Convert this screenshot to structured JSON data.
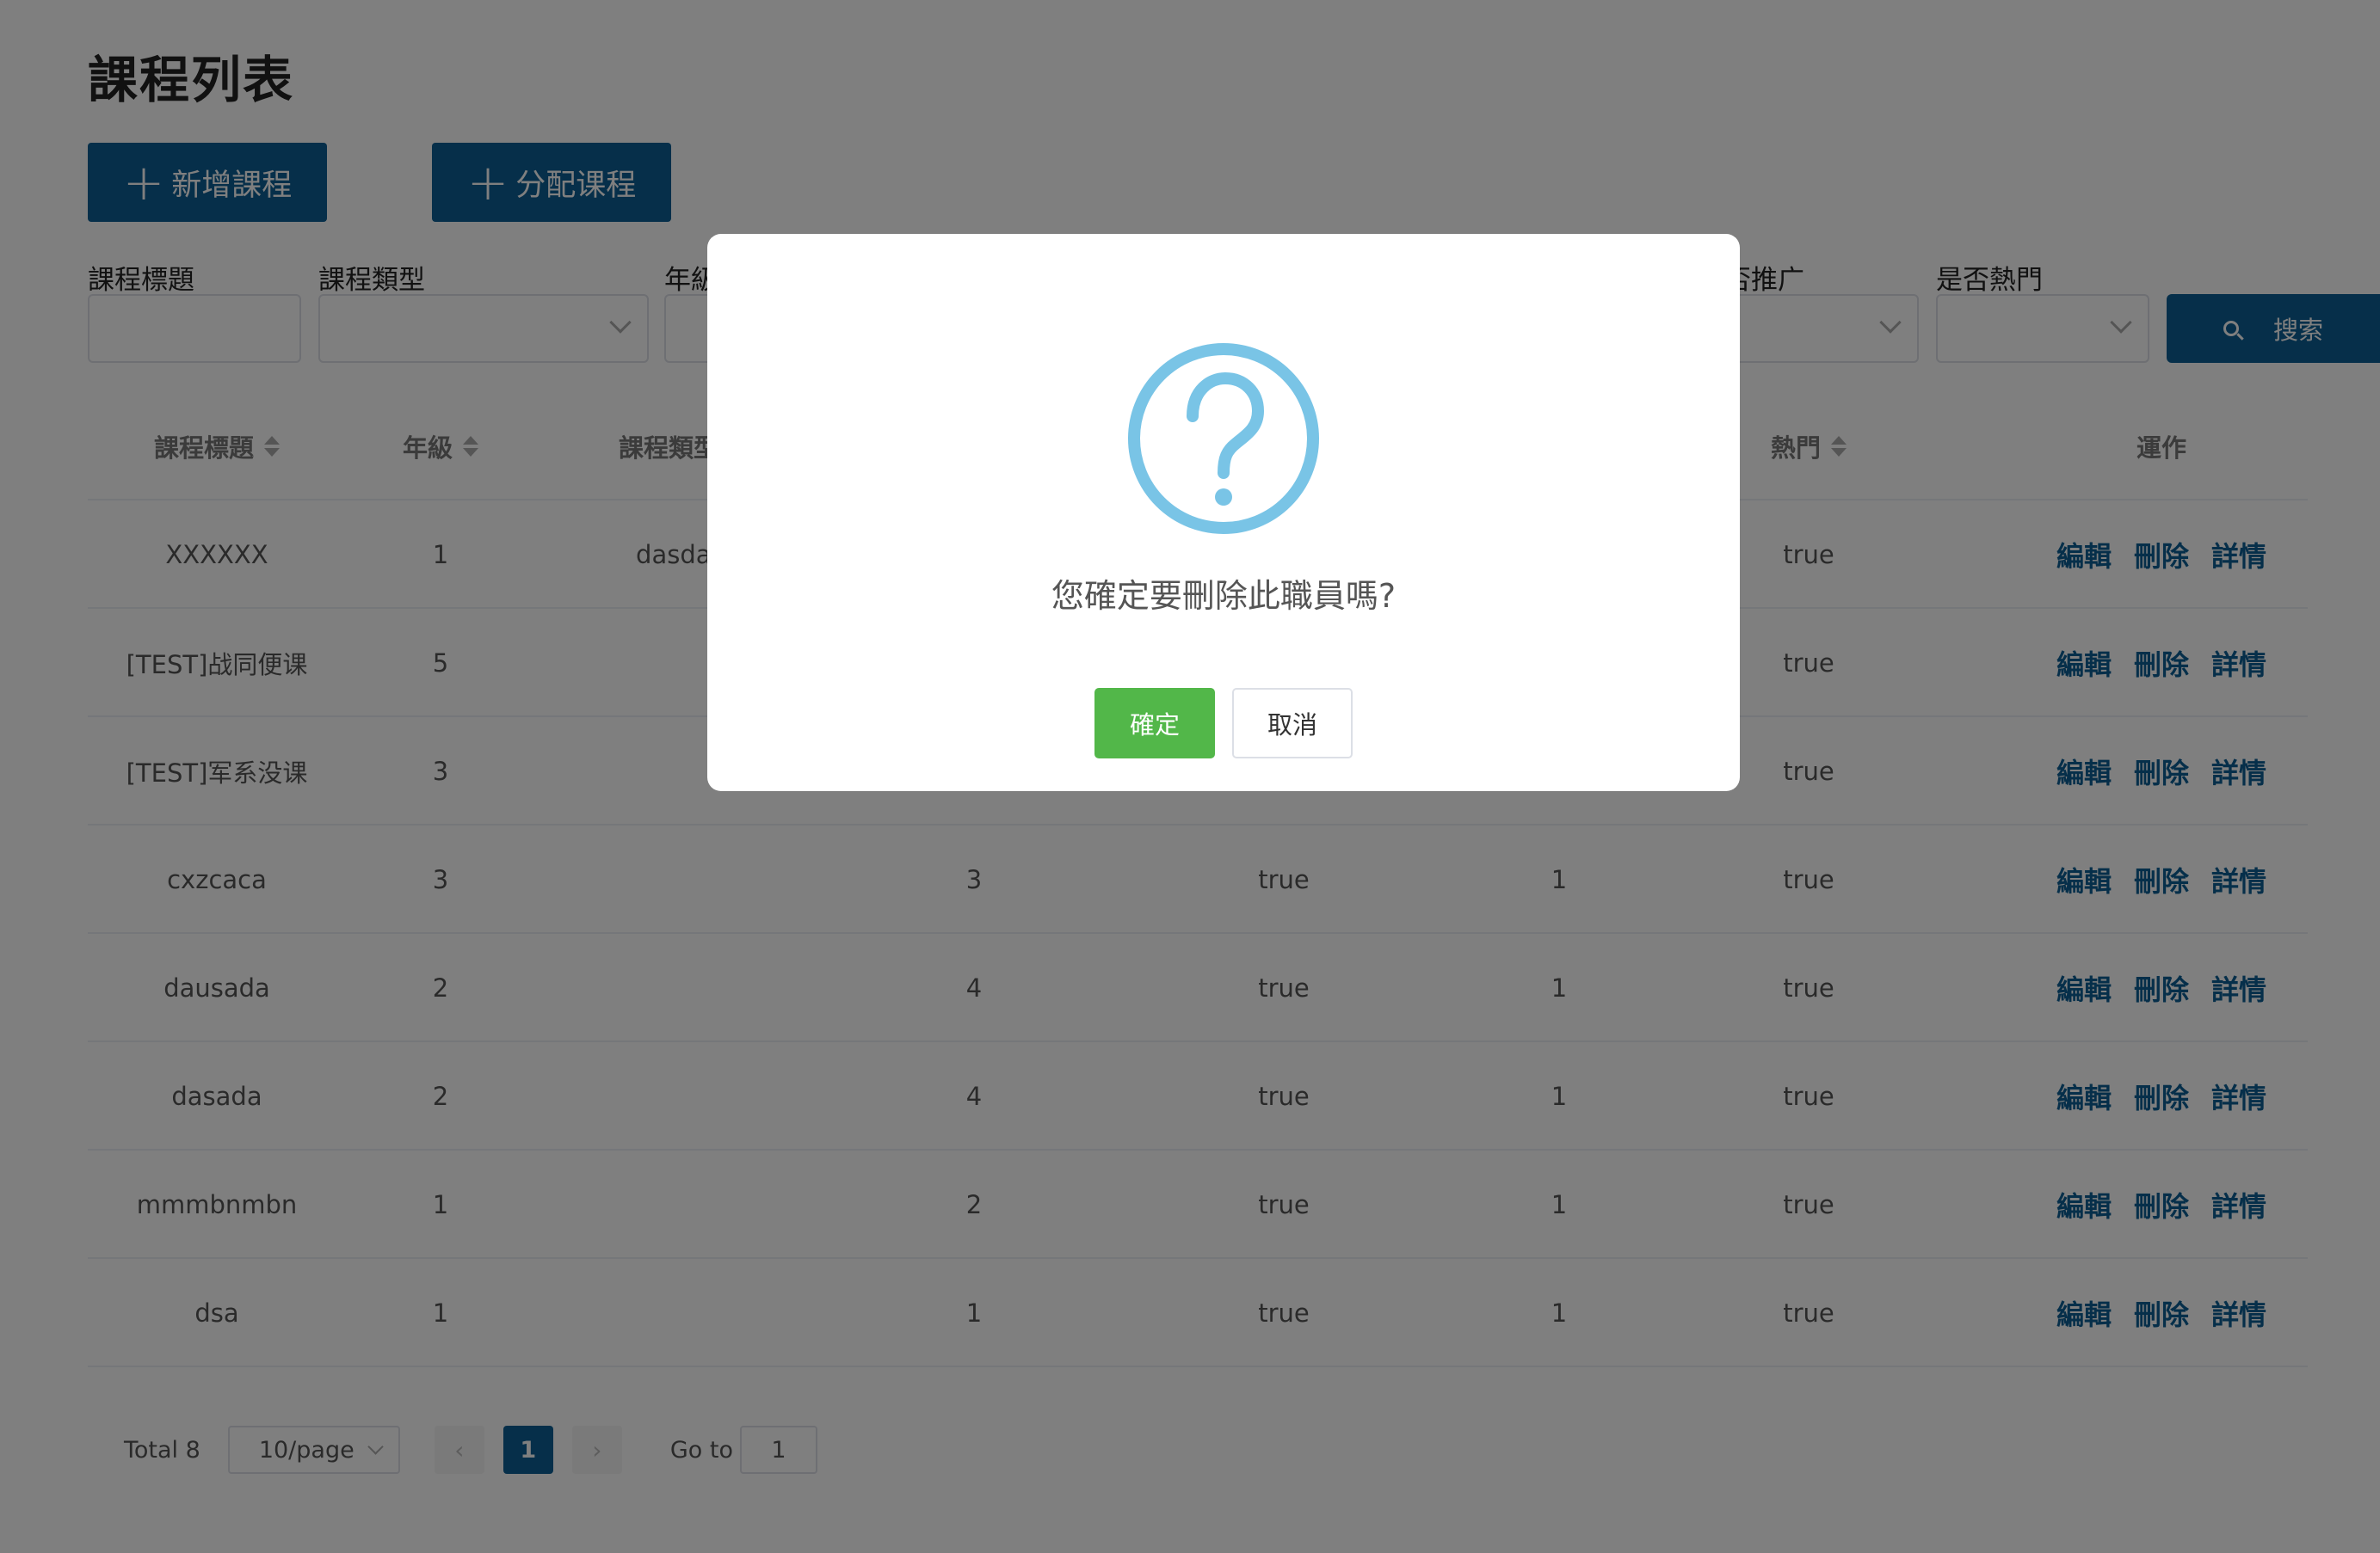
{
  "page": {
    "title": "課程列表"
  },
  "toolbar": {
    "add_label": "新增課程",
    "assign_label": "分配课程"
  },
  "filters": {
    "course_title": "課程標題",
    "course_type": "課程類型",
    "grade": "年級",
    "is_promoted": "否推广",
    "is_popular": "是否熱門",
    "search_label": "搜索"
  },
  "table": {
    "headers": {
      "title": "課程標題",
      "grade": "年級",
      "type": "課程類型",
      "popular": "熱門",
      "ops": "運作"
    },
    "rows": [
      {
        "title": "XXXXXX",
        "grade": "1",
        "type": "dasdad",
        "c4": "",
        "c5": "",
        "c6": "",
        "popular": "true"
      },
      {
        "title": "[TEST]战同便课",
        "grade": "5",
        "type": "",
        "c4": "",
        "c5": "",
        "c6": "",
        "popular": "true"
      },
      {
        "title": "[TEST]军系没课",
        "grade": "3",
        "type": "",
        "c4": "",
        "c5": "",
        "c6": "",
        "popular": "true"
      },
      {
        "title": "cxzcaca",
        "grade": "3",
        "type": "",
        "c4": "3",
        "c5": "true",
        "c6": "1",
        "popular": "true"
      },
      {
        "title": "dausada",
        "grade": "2",
        "type": "",
        "c4": "4",
        "c5": "true",
        "c6": "1",
        "popular": "true"
      },
      {
        "title": "dasada",
        "grade": "2",
        "type": "",
        "c4": "4",
        "c5": "true",
        "c6": "1",
        "popular": "true"
      },
      {
        "title": "mmmbnmbn",
        "grade": "1",
        "type": "",
        "c4": "2",
        "c5": "true",
        "c6": "1",
        "popular": "true"
      },
      {
        "title": "dsa",
        "grade": "1",
        "type": "",
        "c4": "1",
        "c5": "true",
        "c6": "1",
        "popular": "true"
      }
    ],
    "ops": {
      "edit": "編輯",
      "delete": "刪除",
      "details": "詳情"
    }
  },
  "pagination": {
    "total": "Total 8",
    "page_size": "10/page",
    "current": "1",
    "goto_label": "Go to",
    "goto_value": "1"
  },
  "dialog": {
    "message": "您確定要刪除此職員嗎?",
    "confirm": "確定",
    "cancel": "取消"
  },
  "colors": {
    "primary": "#0d5f95",
    "confirm": "#52b749",
    "question_icon": "#79c4e6"
  },
  "icons": {
    "add": "plus-icon",
    "search": "search-icon",
    "dialog": "question-circle-icon"
  }
}
